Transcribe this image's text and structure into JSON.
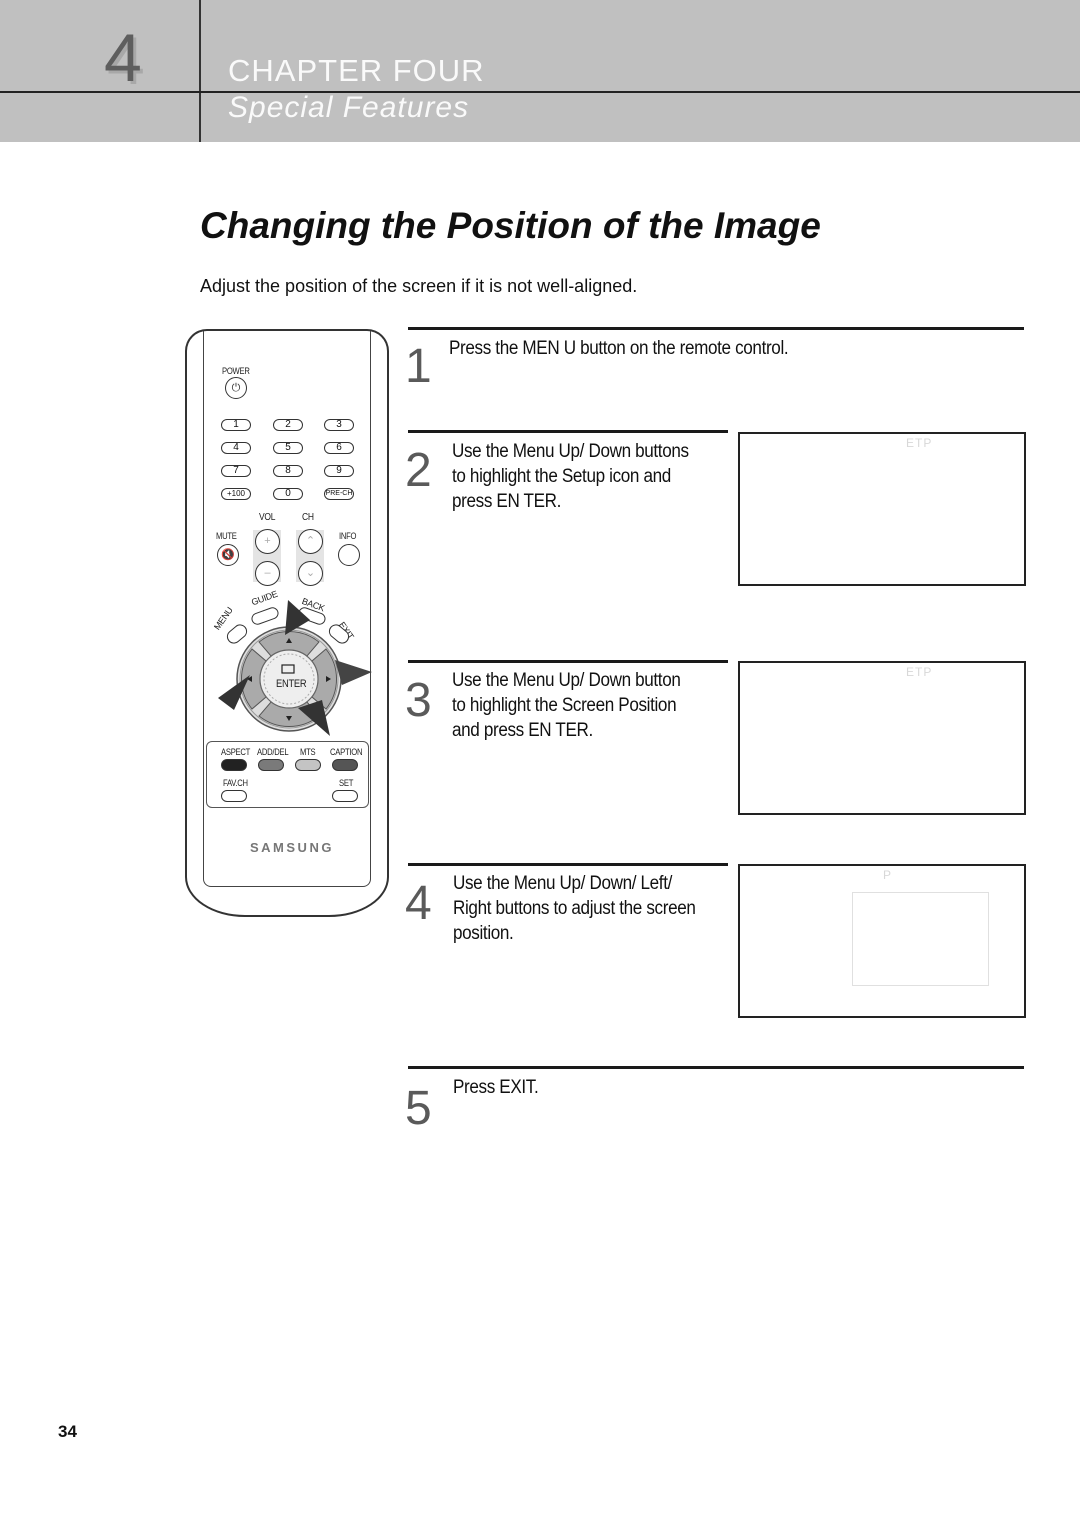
{
  "header": {
    "chapter_number": "4",
    "chapter_title": "CHAPTER FOUR",
    "chapter_subtitle": "Special Features"
  },
  "page": {
    "title": "Changing the Position of the Image",
    "intro": "Adjust the position of the screen if it is not well-aligned.",
    "page_number": "34"
  },
  "remote": {
    "power_label": "POWER",
    "power_glyph": "⏻",
    "number_keys": [
      "1",
      "2",
      "3",
      "4",
      "5",
      "6",
      "7",
      "8",
      "9",
      "+100",
      "0",
      "PRE-CH"
    ],
    "vol_label": "VOL",
    "ch_label": "CH",
    "mute_label": "MUTE",
    "info_label": "INFO",
    "guide_label": "GUIDE",
    "back_label": "BACK",
    "menu_label": "MENU",
    "exit_label": "EXIT",
    "enter_label": "ENTER",
    "aspect_label": "ASPECT",
    "adddel_label": "ADD/DEL",
    "mts_label": "MTS",
    "caption_label": "CAPTION",
    "favch_label": "FAV.CH",
    "set_label": "SET",
    "brand": "SAMSUNG",
    "color_buttons": [
      "#222222",
      "#7a7a7a",
      "#c4c4c4",
      "#555555"
    ]
  },
  "steps": [
    {
      "number": "1",
      "lines": [
        "Press the MEN U button on the remote control."
      ]
    },
    {
      "number": "2",
      "lines": [
        "Use the Menu Up/ Down buttons",
        "to highlight the Setup icon and",
        "press EN TER."
      ],
      "screen_label": "ETP"
    },
    {
      "number": "3",
      "lines": [
        "Use the Menu Up/ Down button",
        "to highlight the Screen Position",
        "and press EN TER."
      ],
      "screen_label": "ETP"
    },
    {
      "number": "4",
      "lines": [
        "Use the Menu Up/ Down/ Left/",
        "Right buttons to adjust the screen",
        "position."
      ],
      "screen_label": "P"
    },
    {
      "number": "5",
      "lines": [
        "Press EXIT."
      ]
    }
  ]
}
